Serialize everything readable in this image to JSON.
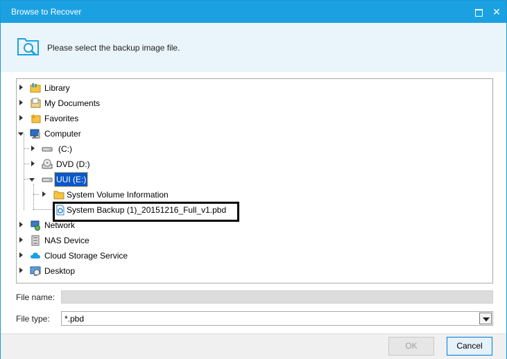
{
  "window": {
    "title": "Browse to Recover"
  },
  "header": {
    "instruction": "Please select the backup image file."
  },
  "tree": {
    "items": [
      {
        "label": "Library",
        "icon": "library-icon"
      },
      {
        "label": "My Documents",
        "icon": "documents-icon"
      },
      {
        "label": "Favorites",
        "icon": "favorites-icon"
      },
      {
        "label": "Computer",
        "icon": "computer-icon"
      },
      {
        "label": "(C:)",
        "icon": "drive-icon"
      },
      {
        "label": "DVD (D:)",
        "icon": "dvd-drive-icon"
      },
      {
        "label": "UUI (E:)",
        "icon": "drive-icon"
      },
      {
        "label": "System Volume Information",
        "icon": "folder-icon"
      },
      {
        "label": "System Backup (1)_20151216_Full_v1.pbd",
        "icon": "backup-file-icon"
      },
      {
        "label": "Network",
        "icon": "network-icon"
      },
      {
        "label": "NAS Device",
        "icon": "nas-icon"
      },
      {
        "label": "Cloud Storage Service",
        "icon": "cloud-icon"
      },
      {
        "label": "Desktop",
        "icon": "desktop-icon"
      }
    ]
  },
  "fields": {
    "file_name_label": "File name:",
    "file_name_value": "",
    "file_type_label": "File type:",
    "file_type_value": "*.pbd"
  },
  "buttons": {
    "ok": "OK",
    "cancel": "Cancel"
  },
  "colors": {
    "titlebar": "#1ba1e2",
    "header_bg": "#e9f4fb",
    "selection": "#0a58c7"
  }
}
